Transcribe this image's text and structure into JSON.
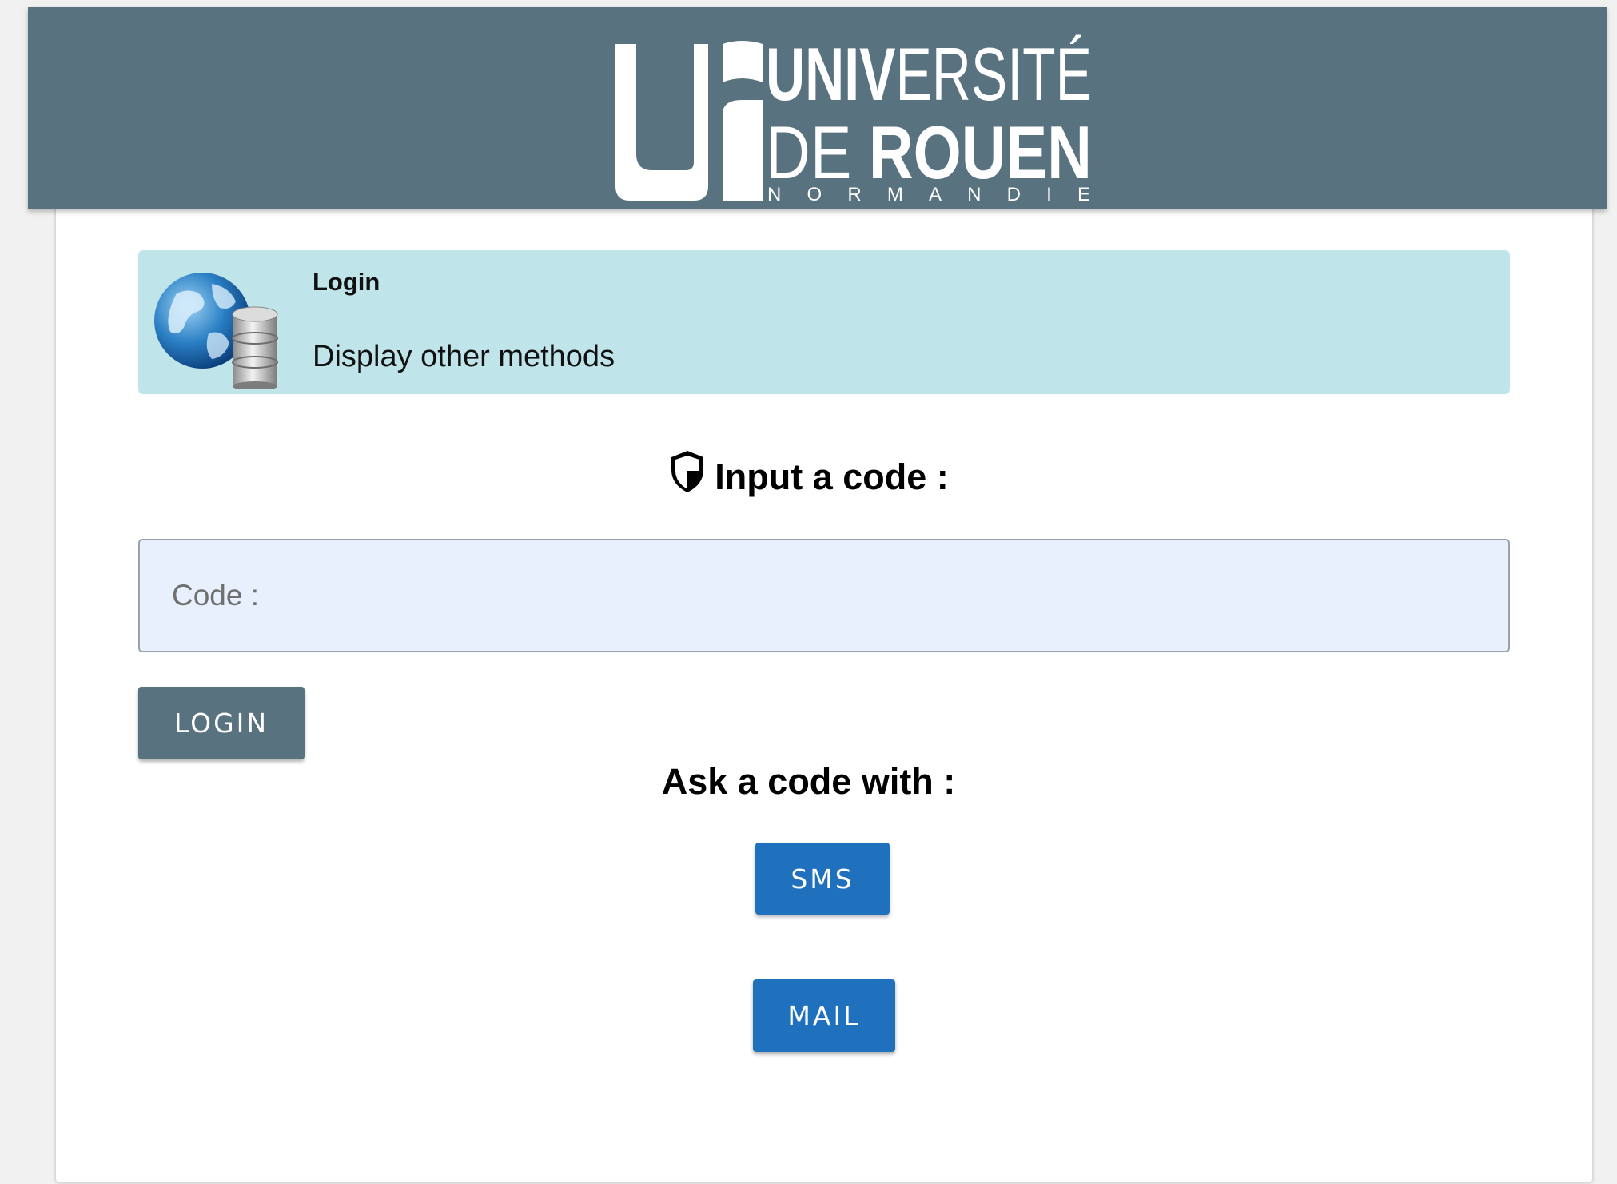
{
  "header": {
    "logo": {
      "line1_bold": "UNIV",
      "line1_light": "ERSITÉ",
      "line2_light": "DE ",
      "line2_bold": "ROUEN",
      "line3": "NORMANDIE"
    }
  },
  "info_box": {
    "title": "Login",
    "link_label": "Display other methods",
    "icon": "globe-database-icon"
  },
  "code_section": {
    "heading": "Input a code :",
    "heading_icon": "shield-icon",
    "input_placeholder": "Code :",
    "input_value": "",
    "login_label": "LOGIN"
  },
  "ask_section": {
    "heading": "Ask a code with :",
    "sms_label": "SMS",
    "mail_label": "MAIL"
  },
  "colors": {
    "header_bg": "#587280",
    "info_bg": "#bfe4ea",
    "input_bg": "#e8f0fe",
    "login_button": "#587280",
    "action_button": "#1f71bd"
  }
}
